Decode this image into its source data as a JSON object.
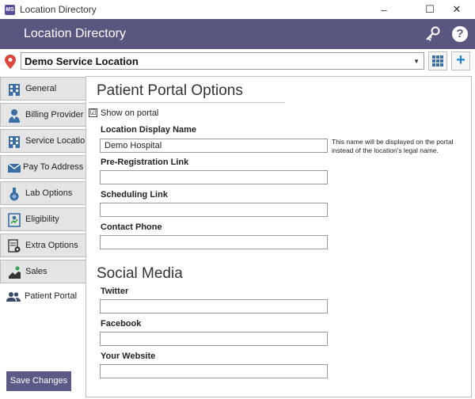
{
  "window": {
    "title": "Location Directory",
    "app_icon": "app-logo",
    "minimize": "–",
    "maximize": "☐",
    "close": "✕"
  },
  "header": {
    "title": "Location Directory",
    "key_icon": "key-icon",
    "help_label": "?"
  },
  "location": {
    "selected": "Demo Service Location",
    "caret": "▼",
    "add_label": "+"
  },
  "sidebar": {
    "items": [
      {
        "label": "General",
        "icon": "building-icon"
      },
      {
        "label": "Billing Provider",
        "icon": "provider-icon"
      },
      {
        "label": "Service Location",
        "icon": "building-icon"
      },
      {
        "label": "Pay To Address",
        "icon": "envelope-icon"
      },
      {
        "label": "Lab Options",
        "icon": "flask-icon"
      },
      {
        "label": "Eligibility",
        "icon": "id-card-icon"
      },
      {
        "label": "Extra Options",
        "icon": "document-gear-icon"
      },
      {
        "label": "Sales",
        "icon": "sales-icon"
      },
      {
        "label": "Patient Portal",
        "icon": "people-icon",
        "active": true
      }
    ],
    "save_label": "Save Changes"
  },
  "portal": {
    "section_title": "Patient Portal Options",
    "show_on_portal_label": "Show on portal",
    "show_on_portal_checked": "☑",
    "display_name_label": "Location Display Name",
    "display_name_value": "Demo Hospital",
    "display_name_hint": "This name will be displayed on the portal instead of the location's legal name.",
    "prereg_label": "Pre-Registration Link",
    "prereg_value": "",
    "scheduling_label": "Scheduling Link",
    "scheduling_value": "",
    "phone_label": "Contact Phone",
    "phone_value": ""
  },
  "social": {
    "section_title": "Social Media",
    "twitter_label": "Twitter",
    "twitter_value": "",
    "facebook_label": "Facebook",
    "facebook_value": "",
    "website_label": "Your Website",
    "website_value": ""
  },
  "colors": {
    "header_bg": "#59577f",
    "accent_blue": "#1e7fd8",
    "pin_red": "#e0443a",
    "save_bg": "#5b5a86"
  }
}
